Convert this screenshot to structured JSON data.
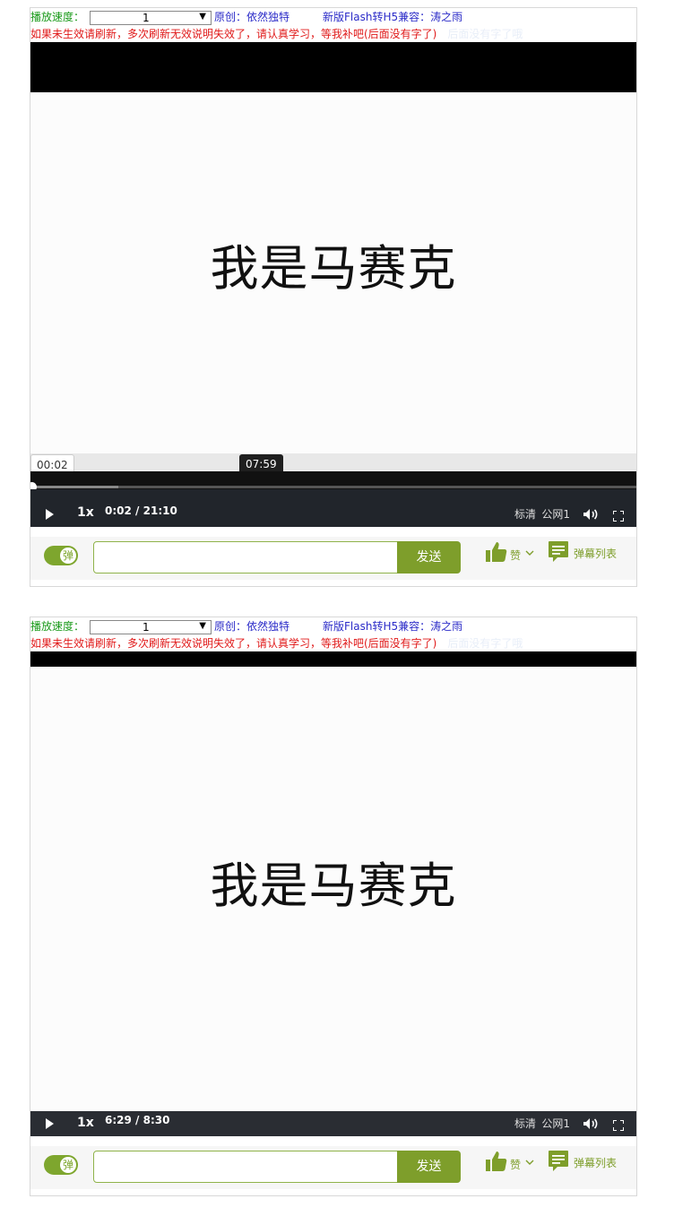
{
  "controls": {
    "speed_label": "播放速度：",
    "speed_value": "1",
    "credit_original": "原创：依然独特",
    "credit_h5": "新版Flash转H5兼容：涛之雨",
    "warning": "如果未生效请刷新，多次刷新无效说明失效了，请认真学习，等我补吧(后面没有字了)",
    "warning_faint": "后面没有字了哦"
  },
  "player1": {
    "subtitle": "我是马赛克",
    "current_time_tip": "00:02",
    "hover_time_tip": "07:59",
    "progress_played": 0.0016,
    "progress_buffered": 0.145,
    "rate": "1x",
    "time_current": "0:02",
    "time_separator": "/",
    "time_total": "21:10",
    "quality": "标清",
    "line": "公网1"
  },
  "player2": {
    "subtitle": "我是马赛克",
    "rate": "1x",
    "time_current": "6:29",
    "time_separator": "/",
    "time_total": "8:30",
    "quality": "标清",
    "line": "公网1"
  },
  "danmu": {
    "toggle_label": "弹",
    "send_label": "发送",
    "like_label": "赞",
    "list_label": "弹幕列表"
  },
  "colors": {
    "accent_green": "#7e9e2b",
    "label_green": "#1a9a1a",
    "credit_blue": "#2b2bc8",
    "warning_red": "#e01a1a"
  }
}
